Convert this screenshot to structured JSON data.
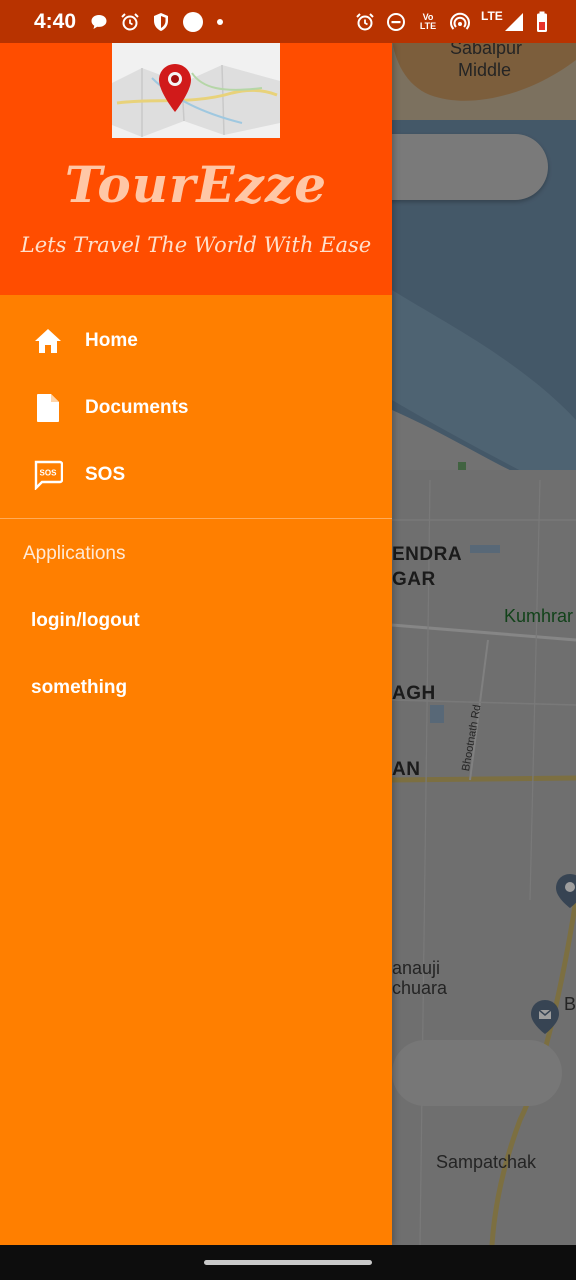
{
  "status_bar": {
    "time": "4:40",
    "network_label": "LTE",
    "volte_label": "Vo LTE"
  },
  "drawer": {
    "brand_title": "TourEzze",
    "tagline": "Lets Travel The World With Ease",
    "menu_items": [
      {
        "label": "Home",
        "icon": "home-icon"
      },
      {
        "label": "Documents",
        "icon": "document-icon"
      },
      {
        "label": "SOS",
        "icon": "sos-message-icon"
      }
    ],
    "section_title": "Applications",
    "app_items": [
      {
        "label": "login/logout"
      },
      {
        "label": "something"
      }
    ]
  },
  "map": {
    "labels": {
      "sabalpur": "Sabalpur",
      "middle": "Middle",
      "endra": "ENDRA",
      "gar": "GAR",
      "kumhrar": "Kumhrar",
      "agh": "AGH",
      "an": "AN",
      "bhootnath": "Bhootnath Rd",
      "anauji": "anauji",
      "chuara": "chuara",
      "sampatchak": "Sampatchak",
      "b": "B"
    }
  },
  "colors": {
    "drawer_bg": "#ff7f00",
    "header_bg": "#ff4d00",
    "status_bar_bg": "#b83300"
  }
}
